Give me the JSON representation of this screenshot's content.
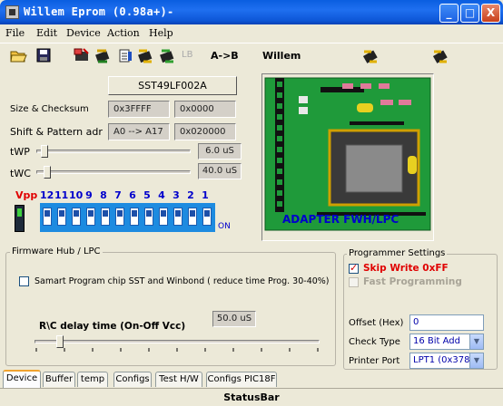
{
  "window": {
    "title": "Willem Eprom (0.98a+)-",
    "minimize": "_",
    "maximize": "□",
    "close": "X"
  },
  "menu": [
    "File",
    "Edit",
    "Device",
    "Action",
    "Help"
  ],
  "toolbar": {
    "lb": "LB",
    "ab": "A->B",
    "willem": "Willem"
  },
  "chip": {
    "name": "SST49LF002A"
  },
  "size_checksum": {
    "label": "Size & Checksum",
    "size": "0x3FFFF",
    "checksum": "0x0000"
  },
  "shift_pattern": {
    "label": "Shift & Pattern adr",
    "shift": "A0 --> A17",
    "pattern": "0x020000"
  },
  "twp": {
    "label": "tWP",
    "value": "6.0 uS",
    "level": 0.03
  },
  "twc": {
    "label": "tWC",
    "value": "40.0 uS",
    "level": 0.05
  },
  "vpp": {
    "label": "Vpp",
    "pins": [
      "12",
      "11",
      "10",
      "9",
      "8",
      "7",
      "6",
      "5",
      "4",
      "3",
      "2",
      "1"
    ],
    "on_label": "ON"
  },
  "adapter": {
    "caption": "ADAPTER FWH/LPC"
  },
  "firmware": {
    "title": "Firmware Hub / LPC",
    "checkbox_label": "Samart Program chip SST and Winbond ( reduce time Prog. 30-40%)",
    "delay_label": "R\\C delay time  (On-Off Vcc)",
    "delay_value": "50.0 uS",
    "delay_level": 0.08
  },
  "programmer": {
    "title": "Programmer Settings",
    "skip_write": "Skip Write 0xFF",
    "fast_programming": "Fast Programming",
    "offset_label": "Offset (Hex)",
    "offset_value": "0",
    "check_type_label": "Check Type",
    "check_type_value": "16 Bit Add",
    "printer_port_label": "Printer Port",
    "printer_port_value": "LPT1 (0x378)"
  },
  "tabs": [
    "Device",
    "Buffer",
    "temp",
    "Configs",
    "Test H/W",
    "Configs PIC18F"
  ],
  "status": "StatusBar",
  "colors": {
    "title_blue": "#0a5ee0",
    "vpp_red": "#e00000",
    "pin_blue": "#0000cc",
    "board_green": "#1f9a3a"
  }
}
